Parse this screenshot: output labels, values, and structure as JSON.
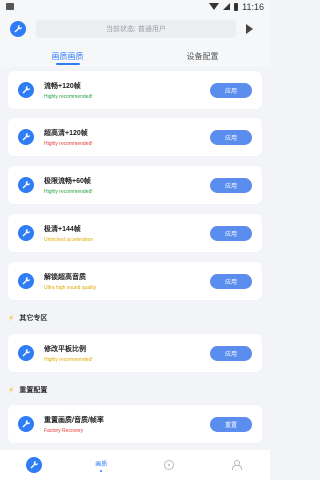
{
  "status_bar": {
    "time": "11:16"
  },
  "header": {
    "status_text": "当前状态: 普通用户"
  },
  "tabs": [
    {
      "label": "画质画质",
      "active": true
    },
    {
      "label": "设备配置",
      "active": false
    }
  ],
  "cards": [
    {
      "title": "流畅+120帧",
      "subtitle": "Highly recommended!",
      "subtitle_color": "#27a045",
      "button": "应用"
    },
    {
      "title": "超高清+120帧",
      "subtitle": "Highly recommended!",
      "subtitle_color": "#e53935",
      "button": "应用"
    },
    {
      "title": "极限流畅+60帧",
      "subtitle": "Highly recommended!",
      "subtitle_color": "#27a045",
      "button": "应用"
    },
    {
      "title": "极清+144帧",
      "subtitle": "Unlocked acceleration",
      "subtitle_color": "#e0a800",
      "button": "应用"
    },
    {
      "title": "解锁超高音质",
      "subtitle": "Ultra high sound quality",
      "subtitle_color": "#e0a800",
      "button": "应用"
    }
  ],
  "section_other": {
    "title": "其它专区"
  },
  "other_cards": [
    {
      "title": "修改平板比例",
      "subtitle": "Highly recommended!",
      "subtitle_color": "#e0a800",
      "button": "应用"
    }
  ],
  "section_reset": {
    "title": "重置配置"
  },
  "reset_cards": [
    {
      "title": "重置画质/音质/帧率",
      "subtitle": "Factory Recovery",
      "subtitle_color": "#e53935",
      "button": "重置"
    }
  ],
  "bottom_nav": [
    {
      "label": "",
      "icon": "tool-icon"
    },
    {
      "label": "画质",
      "icon": "dot-icon",
      "active": true
    },
    {
      "label": "",
      "icon": "compass-icon"
    },
    {
      "label": "",
      "icon": "person-icon"
    }
  ],
  "colors": {
    "accent": "#2f7df6",
    "button": "#5b8def",
    "background": "#f2f4f7"
  }
}
